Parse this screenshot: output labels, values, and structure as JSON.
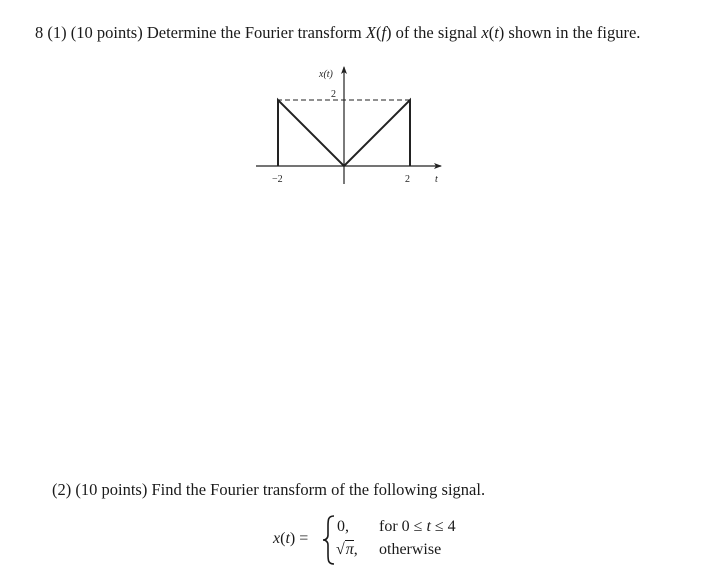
{
  "question": {
    "number": "8",
    "part1": {
      "label": "(1)",
      "points": "(10 points)",
      "text_before": "Determine the Fourier transform",
      "transform_symbol": "X",
      "transform_arg": "(f)",
      "text_middle": "of the signal",
      "signal_symbol": "x",
      "signal_arg": "(t)",
      "text_after": "shown in the figure."
    },
    "part2": {
      "label": "(2)",
      "points": "(10 points)",
      "text": "Find the Fourier transform of the following signal."
    }
  },
  "figure": {
    "y_axis_label": "x(t)",
    "x_axis_label": "t",
    "y_tick_label": "2",
    "x_tick_labels": [
      "−2",
      "2"
    ],
    "signal_points": [
      {
        "t": -2,
        "x": 0
      },
      {
        "t": -2,
        "x": 2
      },
      {
        "t": 0,
        "x": 0
      },
      {
        "t": 2,
        "x": 2
      },
      {
        "t": 2,
        "x": 0
      }
    ],
    "dashed_level": 2
  },
  "equation": {
    "lhs": "x(t) =",
    "cases": [
      {
        "value": "0,",
        "condition": "for 0 ≤ t ≤ 4"
      },
      {
        "value_sqrt": "π",
        "value_suffix": ",",
        "condition": "otherwise"
      }
    ]
  }
}
